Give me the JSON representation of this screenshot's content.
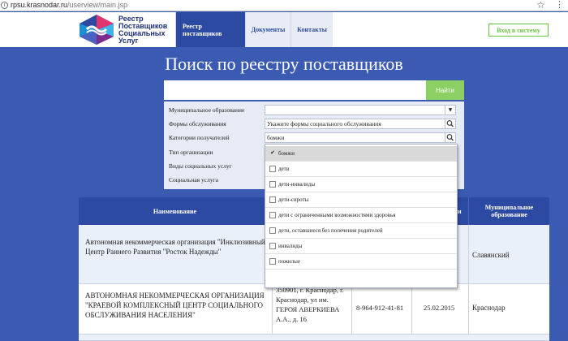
{
  "browser": {
    "url_host": "rpsu.krasnodar.ru",
    "url_path": "/userview/main.jsp"
  },
  "header": {
    "logo_lines": [
      "Реестр",
      "Поставщиков",
      "Социальных",
      "Услуг"
    ],
    "nav": [
      "Реестр поставщиков",
      "Документы",
      "Контакты"
    ],
    "login_label": "Вход в систему"
  },
  "search": {
    "title": "Поиск по реестру поставщиков",
    "value": "",
    "button_label": "Найти"
  },
  "filters": {
    "labels": [
      "Муниципальное образование",
      "Формы обслуживания",
      "Категории получателей",
      "Тип организации",
      "Виды социальных услуг",
      "Социальная услуга"
    ],
    "municipality_value": "",
    "forms_value": "Укажите формы социального обслуживания",
    "categories_value": "бомжи"
  },
  "dropdown": {
    "options": [
      {
        "label": "бомжи",
        "checked": true
      },
      {
        "label": "дети",
        "checked": false
      },
      {
        "label": "дети-инвалиды",
        "checked": false
      },
      {
        "label": "дети-сироты",
        "checked": false
      },
      {
        "label": "дети с ограниченными возможностями здоровья",
        "checked": false
      },
      {
        "label": "дети, оставшиеся без попечения родителей",
        "checked": false
      },
      {
        "label": "инвалиды",
        "checked": false
      },
      {
        "label": "пожилые",
        "checked": false
      }
    ]
  },
  "table": {
    "headers": {
      "name": "Наименование",
      "hidden": "и",
      "municipality": "Муниципальное образование"
    },
    "rows": [
      {
        "name": "Автономная некоммерческая организация \"Инклюзивный Центр Раннего Развития \"Росток Надежды\"",
        "address": "",
        "phone": "",
        "date": "",
        "municipality": "Славянский"
      },
      {
        "name": "АВТОНОМНАЯ НЕКОММЕРЧЕСКАЯ ОРГАНИЗАЦИЯ \"КРАЕВОЙ КОМПЛЕКСНЫЙ ЦЕНТР СОЦИАЛЬНОГО ОБСЛУЖИВАНИЯ НАСЕЛЕНИЯ\"",
        "address": "350901, г. Краснодар, г. Краснодар, ул им. ГЕРОЯ АВЕРКИЕВА А.А., д. 16",
        "phone": "8-964-912-41-81",
        "date": "25.02.2015",
        "municipality": "Краснодар"
      }
    ]
  },
  "colors": {
    "primary": "#2d4aa3",
    "background": "#3b5bb3",
    "accent_green": "#8ccf62"
  }
}
